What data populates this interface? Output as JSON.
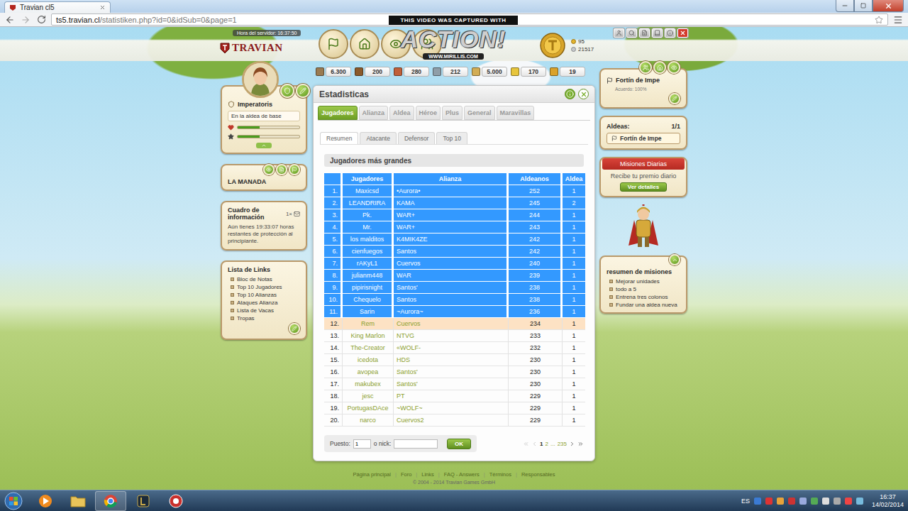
{
  "browser": {
    "tab_title": "Travian cl5",
    "url_host": "ts5.travian.cl",
    "url_path": "/statistiken.php?id=0&idSub=0&page=1",
    "bookmarked": false
  },
  "watermark": {
    "caption": "THIS VIDEO WAS CAPTURED WITH",
    "logo": "ACTION!",
    "site": "WWW.MIRILLIS.COM"
  },
  "header": {
    "server_time_label": "Hora del servidor:",
    "server_time": "16:37:50",
    "logo": "TRAVIAN",
    "gold": "95",
    "silver": "21517"
  },
  "resources": [
    {
      "kind": "warehouse",
      "value": "6.300"
    },
    {
      "kind": "wood",
      "value": "200"
    },
    {
      "kind": "clay",
      "value": "280"
    },
    {
      "kind": "iron",
      "value": "212"
    },
    {
      "kind": "granary",
      "value": "5.000"
    },
    {
      "kind": "crop",
      "value": "170"
    },
    {
      "kind": "freecrop",
      "value": "19"
    }
  ],
  "hero": {
    "name": "Imperatoris",
    "status": "En la aldea de base",
    "health": 0.36,
    "experience": 0.36
  },
  "alliance": {
    "name": "LA MANADA"
  },
  "info_box": {
    "title": "Cuadro de información",
    "count": "1×",
    "message": "Aún tienes 19:33:07 horas restantes de protección al principiante."
  },
  "links": {
    "title": "Lista de Links",
    "items": [
      "Bloc de Notas",
      "Top 10 Jugadores",
      "Top 10 Alianzas",
      "Ataques Alianza",
      "Lista de Vacas",
      "Tropas"
    ]
  },
  "statistics": {
    "title": "Estadisticas",
    "tabs": [
      {
        "label": "Jugadores",
        "selected": true
      },
      {
        "label": "Alianza",
        "selected": false
      },
      {
        "label": "Aldea",
        "selected": false
      },
      {
        "label": "Héroe",
        "selected": false
      },
      {
        "label": "Plus",
        "selected": false
      },
      {
        "label": "General",
        "selected": false
      },
      {
        "label": "Maravillas",
        "selected": false
      }
    ],
    "subtabs": [
      {
        "label": "Resumen",
        "selected": true
      },
      {
        "label": "Atacante",
        "selected": false
      },
      {
        "label": "Defensor",
        "selected": false
      },
      {
        "label": "Top 10",
        "selected": false
      }
    ],
    "heading": "Jugadores más grandes",
    "table": {
      "columns": [
        "Jugadores",
        "Alianza",
        "Aldeanos",
        "Aldea"
      ],
      "header_selected": true,
      "rows": [
        {
          "rank": "1.",
          "player": "Maxicsd",
          "alliance": "•Aurora•",
          "population": "252",
          "villages": "1",
          "selected": true,
          "highlighted": false
        },
        {
          "rank": "2.",
          "player": "LEANDRIRA",
          "alliance": "KAMA",
          "population": "245",
          "villages": "2",
          "selected": true,
          "highlighted": false
        },
        {
          "rank": "3.",
          "player": "Pk.",
          "alliance": "WAR+",
          "population": "244",
          "villages": "1",
          "selected": true,
          "highlighted": false
        },
        {
          "rank": "4.",
          "player": "Mr.",
          "alliance": "WAR+",
          "population": "243",
          "villages": "1",
          "selected": true,
          "highlighted": false
        },
        {
          "rank": "5.",
          "player": "los malditos",
          "alliance": "K4MIK4ZE",
          "population": "242",
          "villages": "1",
          "selected": true,
          "highlighted": false
        },
        {
          "rank": "6.",
          "player": "cienfuegos",
          "alliance": "Santos",
          "population": "242",
          "villages": "1",
          "selected": true,
          "highlighted": false
        },
        {
          "rank": "7.",
          "player": "rAKyL1",
          "alliance": "Cuervos",
          "population": "240",
          "villages": "1",
          "selected": true,
          "highlighted": false
        },
        {
          "rank": "8.",
          "player": "julianm448",
          "alliance": "WAR",
          "population": "239",
          "villages": "1",
          "selected": true,
          "highlighted": false
        },
        {
          "rank": "9.",
          "player": "pipirisnight",
          "alliance": "Santos'",
          "population": "238",
          "villages": "1",
          "selected": true,
          "highlighted": false
        },
        {
          "rank": "10.",
          "player": "Chequelo",
          "alliance": "Santos",
          "population": "238",
          "villages": "1",
          "selected": true,
          "highlighted": false
        },
        {
          "rank": "11.",
          "player": "Sarin",
          "alliance": "~Aurora~",
          "population": "236",
          "villages": "1",
          "selected": true,
          "highlighted": false
        },
        {
          "rank": "12.",
          "player": "Rem",
          "alliance": "Cuervos",
          "population": "234",
          "villages": "1",
          "selected": false,
          "highlighted": true
        },
        {
          "rank": "13.",
          "player": "King Marlon",
          "alliance": "NTVG",
          "population": "233",
          "villages": "1",
          "selected": false,
          "highlighted": false
        },
        {
          "rank": "14.",
          "player": "The-Creator",
          "alliance": "«WOLF-",
          "population": "232",
          "villages": "1",
          "selected": false,
          "highlighted": false
        },
        {
          "rank": "15.",
          "player": "icedota",
          "alliance": "HDS",
          "population": "230",
          "villages": "1",
          "selected": false,
          "highlighted": false
        },
        {
          "rank": "16.",
          "player": "avopea",
          "alliance": "Santos'",
          "population": "230",
          "villages": "1",
          "selected": false,
          "highlighted": false
        },
        {
          "rank": "17.",
          "player": "makubex",
          "alliance": "Santos'",
          "population": "230",
          "villages": "1",
          "selected": false,
          "highlighted": false
        },
        {
          "rank": "18.",
          "player": "jesc",
          "alliance": "PT",
          "population": "229",
          "villages": "1",
          "selected": false,
          "highlighted": false
        },
        {
          "rank": "19.",
          "player": "PortugasDAce",
          "alliance": "~WOLF~",
          "population": "229",
          "villages": "1",
          "selected": false,
          "highlighted": false
        },
        {
          "rank": "20.",
          "player": "narco",
          "alliance": "Cuervos2",
          "population": "229",
          "villages": "1",
          "selected": false,
          "highlighted": false
        }
      ]
    },
    "search": {
      "rank_label": "Puesto:",
      "rank_value": "1",
      "nick_label": "o nick:",
      "nick_value": "",
      "button": "OK"
    },
    "pagination": {
      "pages": [
        {
          "label": "1",
          "selected": true
        },
        {
          "label": "2",
          "selected": false
        },
        {
          "label": "...",
          "selected": false
        },
        {
          "label": "235",
          "selected": false
        }
      ],
      "previous_enabled": false,
      "next_enabled": true
    }
  },
  "village": {
    "name": "Fortín de Impe",
    "loyalty": "Acuerdo: 100%"
  },
  "villages": {
    "label": "Aldeas:",
    "count": "1/1",
    "items": [
      {
        "name": "Fortín de Impe",
        "selected": true
      }
    ]
  },
  "daily_quests": {
    "title": "Misiones Diarias",
    "text": "Recibe tu premio diario",
    "button": "Ver detalles"
  },
  "missions": {
    "title": "resumen de misiones",
    "items": [
      "Mejorar unidades",
      "todo a 5",
      "Entrena tres colonos",
      "Fundar una aldea nueva"
    ]
  },
  "footer": {
    "links": [
      "Página principal",
      "Foro",
      "Links",
      "FAQ - Answers",
      "Términos",
      "Responsables"
    ],
    "separator": "|",
    "copyright": "© 2004 - 2014 Travian Games GmbH"
  },
  "taskbar": {
    "language": "ES",
    "time": "16:37",
    "date": "14/02/2014"
  }
}
